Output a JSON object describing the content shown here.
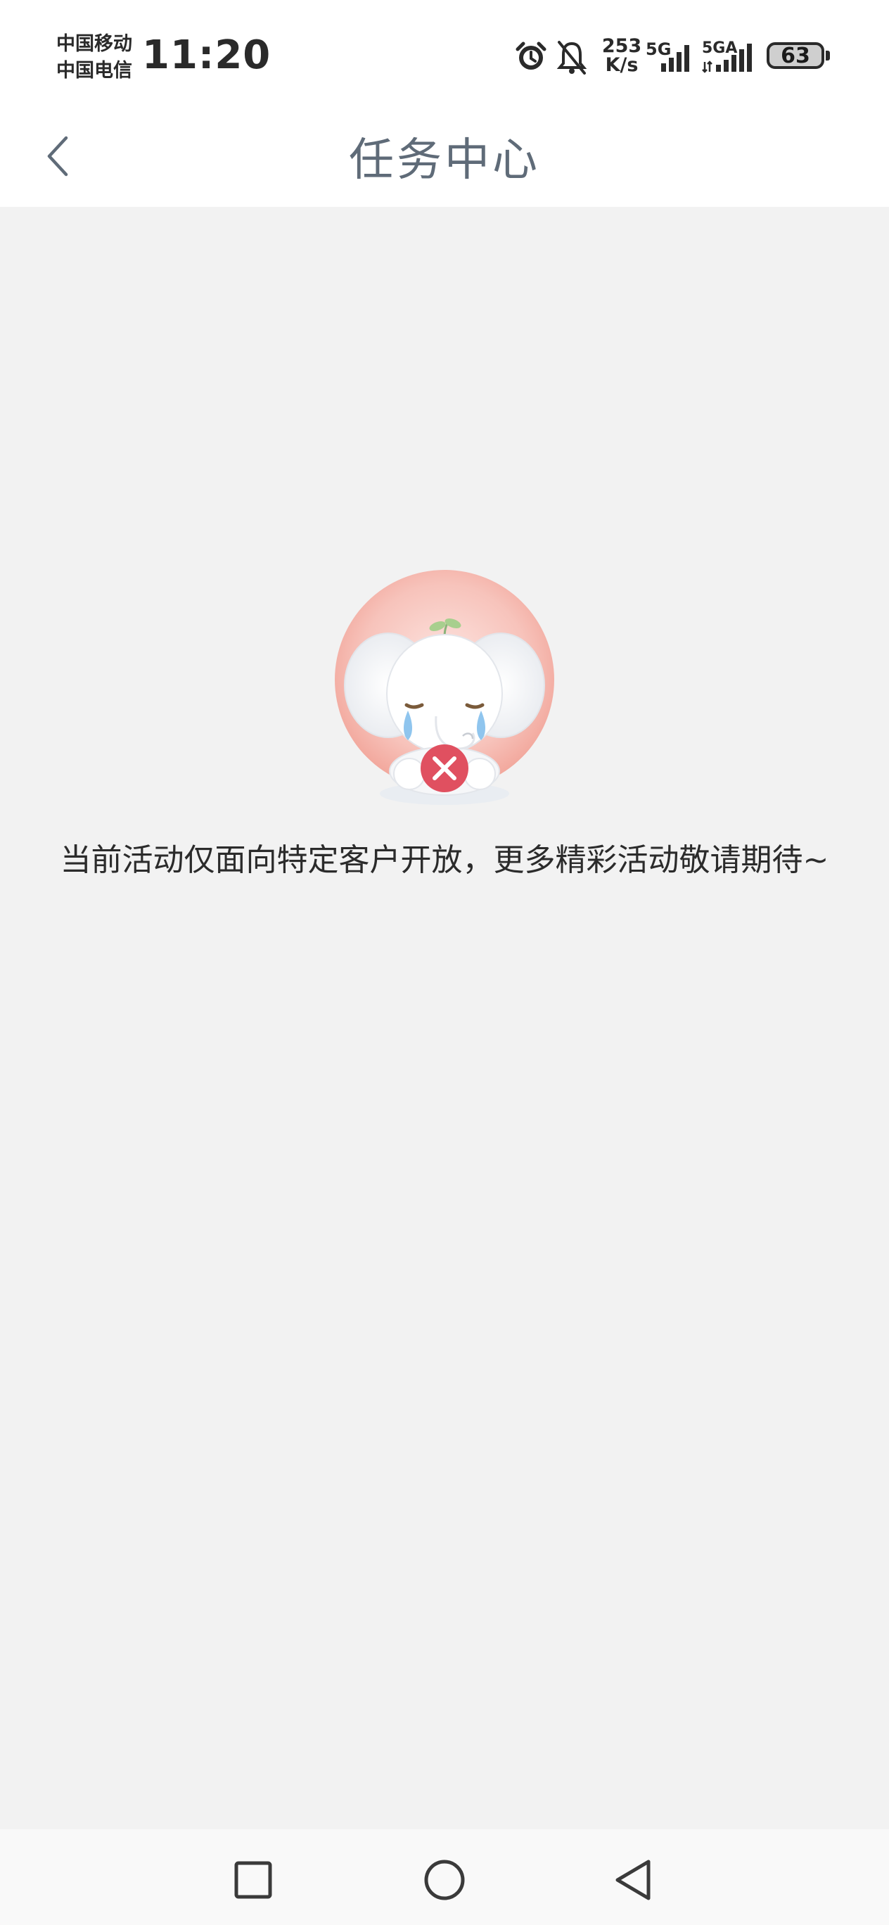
{
  "status_bar": {
    "carrier_1": "中国移动",
    "carrier_2": "中国电信",
    "time": "11:20",
    "net_speed_value": "253",
    "net_speed_unit": "K/s",
    "signal_1_label": "5G",
    "signal_2_label": "5GA",
    "battery": "63",
    "icons": [
      "alarm-icon",
      "mute-bell-icon",
      "signal-5g-icon",
      "signal-5ga-icon",
      "battery-icon"
    ]
  },
  "header": {
    "title": "任务中心",
    "back_icon": "chevron-left-icon"
  },
  "empty_state": {
    "message": "当前活动仅面向特定客户开放，更多精彩活动敬请期待~",
    "illustration": "crying-elephant-with-x"
  },
  "nav_bar": {
    "icons": [
      "recent-apps-square-icon",
      "home-circle-icon",
      "back-triangle-icon"
    ]
  },
  "colors": {
    "background": "#f2f2f2",
    "header_bg": "#ffffff",
    "title": "#5f6b78",
    "accent_red": "#e05060"
  }
}
